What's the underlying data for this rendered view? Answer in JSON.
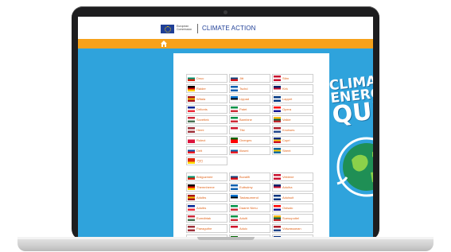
{
  "header": {
    "eu_org": "European Commission",
    "title": "CLIMATE ACTION"
  },
  "quiz": {
    "line1": "CLIMATE&",
    "line2": "ENERGY",
    "line3": "QUIZ"
  },
  "languages_group1": [
    {
      "label": "Dnuc",
      "flag": [
        "#ffffff",
        "#00966e",
        "#d62612"
      ]
    },
    {
      "label": "Jitt",
      "flag": [
        "#ffffff",
        "#11457e",
        "#d7141a"
      ]
    },
    {
      "label": "Stirn",
      "flag": [
        "#c8102e",
        "#ffffff",
        "#c8102e"
      ]
    },
    {
      "label": "Raider",
      "flag": [
        "#000000",
        "#dd0000",
        "#ffce00"
      ]
    },
    {
      "label": "Tschd",
      "flag": [
        "#0d5eaf",
        "#ffffff",
        "#0d5eaf"
      ]
    },
    {
      "label": "Kirk",
      "flag": [
        "#012169",
        "#c8102e",
        "#ffffff"
      ]
    },
    {
      "label": "Witala",
      "flag": [
        "#aa151b",
        "#f1bf00",
        "#aa151b"
      ]
    },
    {
      "label": "Lippad",
      "flag": [
        "#0072ce",
        "#000000",
        "#ffffff"
      ]
    },
    {
      "label": "Lappet",
      "flag": [
        "#003580",
        "#ffffff",
        "#003580"
      ]
    },
    {
      "label": "Drifonts",
      "flag": [
        "#002395",
        "#ffffff",
        "#ed2939"
      ]
    },
    {
      "label": "Patet",
      "flag": [
        "#009246",
        "#ffffff",
        "#ce2b37"
      ]
    },
    {
      "label": "Opera",
      "flag": [
        "#ff0000",
        "#ffffff",
        "#171796"
      ]
    },
    {
      "label": "Sovettek",
      "flag": [
        "#ce2939",
        "#ffffff",
        "#477050"
      ]
    },
    {
      "label": "Bambine",
      "flag": [
        "#009246",
        "#ffffff",
        "#ce2b37"
      ]
    },
    {
      "label": "Valkie",
      "flag": [
        "#fdb913",
        "#006a44",
        "#c1272d"
      ]
    },
    {
      "label": "Hemi",
      "flag": [
        "#9e3039",
        "#ffffff",
        "#9e3039"
      ]
    },
    {
      "label": "Tfst",
      "flag": [
        "#cf142b",
        "#ffffff",
        "#ffffff"
      ]
    },
    {
      "label": "Knotwes",
      "flag": [
        "#ae1c28",
        "#ffffff",
        "#21468b"
      ]
    },
    {
      "label": "Rolect",
      "flag": [
        "#ffffff",
        "#dc143c",
        "#dc143c"
      ]
    },
    {
      "label": "Onerges",
      "flag": [
        "#006600",
        "#ff0000",
        "#ff0000"
      ]
    },
    {
      "label": "Copri",
      "flag": [
        "#002b7f",
        "#fcd116",
        "#ce1126"
      ]
    },
    {
      "label": "Delt",
      "flag": [
        "#ffffff",
        "#0b4ea2",
        "#ee1c25"
      ]
    },
    {
      "label": "Illosmi",
      "flag": [
        "#ffffff",
        "#005da4",
        "#ed1c24"
      ]
    },
    {
      "label": "Sbent",
      "flag": [
        "#006aa7",
        "#fecc00",
        "#006aa7"
      ]
    },
    {
      "label": "刁刃",
      "flag": [
        "#de2910",
        "#de2910",
        "#ffde00"
      ]
    }
  ],
  "languages_group2": [
    {
      "label": "Brdguzmee",
      "flag": [
        "#ffffff",
        "#00966e",
        "#d62612"
      ]
    },
    {
      "label": "Buvalifi",
      "flag": [
        "#ffffff",
        "#11457e",
        "#d7141a"
      ]
    },
    {
      "label": "Vektene",
      "flag": [
        "#c8102e",
        "#ffffff",
        "#c8102e"
      ]
    },
    {
      "label": "Themnherne",
      "flag": [
        "#000000",
        "#dd0000",
        "#ffce00"
      ]
    },
    {
      "label": "Euttsdmy",
      "flag": [
        "#0d5eaf",
        "#ffffff",
        "#0d5eaf"
      ]
    },
    {
      "label": "Aduiha",
      "flag": [
        "#012169",
        "#c8102e",
        "#ffffff"
      ]
    },
    {
      "label": "Aduibs",
      "flag": [
        "#aa151b",
        "#f1bf00",
        "#aa151b"
      ]
    },
    {
      "label": "Tastasumend",
      "flag": [
        "#0072ce",
        "#000000",
        "#ffffff"
      ]
    },
    {
      "label": "Aduisuit",
      "flag": [
        "#003580",
        "#ffffff",
        "#003580"
      ]
    },
    {
      "label": "Aduibs",
      "flag": [
        "#002395",
        "#ffffff",
        "#ed2939"
      ]
    },
    {
      "label": "Daarre Nimu",
      "flag": [
        "#009246",
        "#ffffff",
        "#ce2b37"
      ]
    },
    {
      "label": "Ostsalc",
      "flag": [
        "#ff0000",
        "#ffffff",
        "#171796"
      ]
    },
    {
      "label": "Eumdbtak",
      "flag": [
        "#ce2939",
        "#ffffff",
        "#477050"
      ]
    },
    {
      "label": "Aduiti",
      "flag": [
        "#009246",
        "#ffffff",
        "#ce2b37"
      ]
    },
    {
      "label": "Suesuputiel",
      "flag": [
        "#fdb913",
        "#006a44",
        "#c1272d"
      ]
    },
    {
      "label": "Paeaguthe",
      "flag": [
        "#9e3039",
        "#ffffff",
        "#9e3039"
      ]
    },
    {
      "label": "Aduic",
      "flag": [
        "#cf142b",
        "#ffffff",
        "#ffffff"
      ]
    },
    {
      "label": "Volwassanan",
      "flag": [
        "#ae1c28",
        "#ffffff",
        "#21468b"
      ]
    },
    {
      "label": "Rorsld",
      "flag": [
        "#ffffff",
        "#dc143c",
        "#dc143c"
      ]
    },
    {
      "label": "Aduibs",
      "flag": [
        "#006600",
        "#ff0000",
        "#ff0000"
      ]
    },
    {
      "label": "Aduizi",
      "flag": [
        "#002b7f",
        "#fcd116",
        "#ce1126"
      ]
    }
  ]
}
